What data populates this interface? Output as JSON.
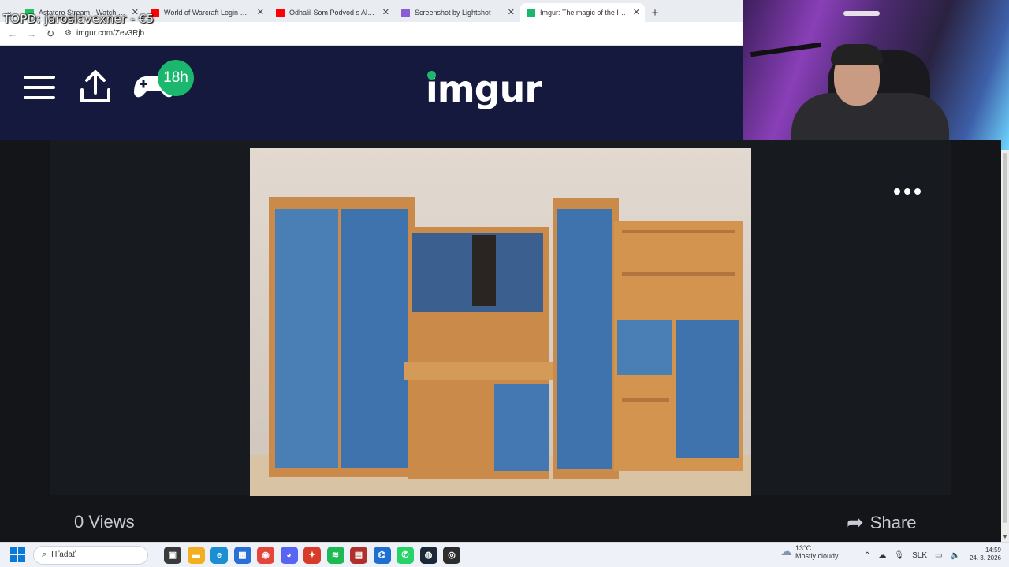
{
  "overlay": {
    "text": "TOPD: jaroslavexner - €5"
  },
  "browser": {
    "tabs": [
      {
        "title": "Astatoro Stream - Watch Live on",
        "favicon_color": "#21c15f",
        "active": false
      },
      {
        "title": "World of Warcraft Login Music",
        "favicon_color": "#ff0000",
        "active": false
      },
      {
        "title": "Odhalil Som Podvod s Alzou",
        "favicon_color": "#ff0000",
        "active": false
      },
      {
        "title": "Screenshot by Lightshot",
        "favicon_color": "#8a5cd6",
        "active": false
      },
      {
        "title": "Imgur: The magic of the Internet",
        "favicon_color": "#1bb76e",
        "active": true
      }
    ],
    "tab_menu_icon": "chevron-down-icon",
    "new_tab_label": "+",
    "url": "imgur.com/Zev3Rjb"
  },
  "imgur": {
    "logo_text": "imgur",
    "badge_text": "18h",
    "brand_green": "#1bb76e",
    "header_color": "#15193d"
  },
  "post": {
    "views_label": "0 Views",
    "share_label": "Share"
  },
  "taskbar": {
    "search_placeholder": "Hľadať",
    "apps": [
      {
        "name": "task-view",
        "color": "#3a3a3a",
        "glyph": "▣"
      },
      {
        "name": "file-explorer",
        "color": "#f2b01e",
        "glyph": "▬"
      },
      {
        "name": "edge",
        "color": "#1b8fd2",
        "glyph": "e"
      },
      {
        "name": "store",
        "color": "#2a6fd6",
        "glyph": "▦"
      },
      {
        "name": "chrome",
        "color": "#e5463b",
        "glyph": "◉"
      },
      {
        "name": "discord",
        "color": "#5865f2",
        "glyph": "◕"
      },
      {
        "name": "app-red",
        "color": "#d83b2a",
        "glyph": "✦"
      },
      {
        "name": "spotify",
        "color": "#1db954",
        "glyph": "≋"
      },
      {
        "name": "app-grid",
        "color": "#b0302a",
        "glyph": "▤"
      },
      {
        "name": "app-blue",
        "color": "#1f6fd0",
        "glyph": "⌬"
      },
      {
        "name": "whatsapp",
        "color": "#25d366",
        "glyph": "✆"
      },
      {
        "name": "steam",
        "color": "#1b2838",
        "glyph": "◍"
      },
      {
        "name": "obs",
        "color": "#2d2d2d",
        "glyph": "◎"
      }
    ],
    "weather_temp": "13°C",
    "weather_desc": "Mostly cloudy",
    "language": "SLK",
    "time": "14:59",
    "date": "24. 3. 2026"
  }
}
